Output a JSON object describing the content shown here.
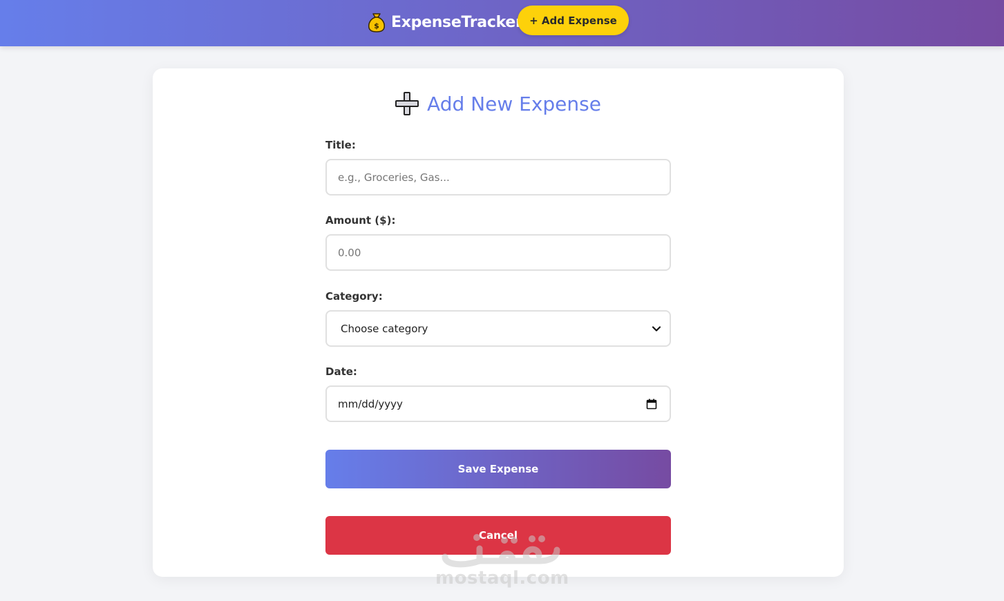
{
  "navbar": {
    "brand_icon": "money-bag-icon",
    "brand": "ExpenseTracker",
    "add_button": "+ Add Expense",
    "gradient": [
      "#667eea",
      "#764ba2"
    ],
    "accent": "#fdd10a"
  },
  "form": {
    "heading_icon": "plus-icon",
    "heading": "Add New Expense",
    "title_label": "Title:",
    "title_placeholder": "e.g., Groceries, Gas...",
    "amount_label": "Amount ($):",
    "amount_placeholder": "0.00",
    "category_label": "Category:",
    "category_selected": "Choose category",
    "date_label": "Date:",
    "date_value": "mm/dd/yyyy",
    "save_button": "Save Expense",
    "cancel_button": "Cancel",
    "cancel_color": "#dc3545"
  },
  "watermark": {
    "text": "mostaql.com"
  }
}
